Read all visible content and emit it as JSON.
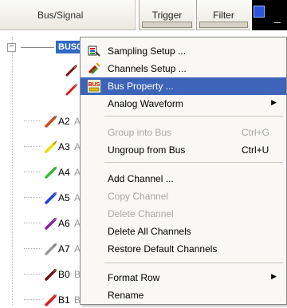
{
  "header": {
    "bus_signal_label": "Bus/Signal",
    "trigger_label": "Trigger",
    "filter_label": "Filter"
  },
  "tree": {
    "bus_name": "BUS0",
    "channels": [
      {
        "name": "A2",
        "extra": "A",
        "color": "#d24a1a"
      },
      {
        "name": "A3",
        "extra": "A",
        "color": "#e8e000"
      },
      {
        "name": "A4",
        "extra": "A",
        "color": "#2fbf2f"
      },
      {
        "name": "A5",
        "extra": "A",
        "color": "#1f3de0"
      },
      {
        "name": "A6",
        "extra": "A",
        "color": "#8a1fa8"
      },
      {
        "name": "A7",
        "extra": "A",
        "color": "#9a9a9a"
      },
      {
        "name": "B0",
        "extra": "B",
        "color": "#6a1010"
      },
      {
        "name": "B1",
        "extra": "B",
        "color": "#e01818"
      }
    ]
  },
  "context_menu": {
    "items": [
      {
        "label": "Sampling Setup ...",
        "icon": "sampling-setup-icon"
      },
      {
        "label": "Channels Setup ...",
        "icon": "channels-setup-icon"
      },
      {
        "label": "Bus Property ...",
        "icon": "bus-property-icon",
        "highlighted": true
      },
      {
        "label": "Analog Waveform",
        "submenu": true
      },
      {
        "label": "Group into Bus",
        "shortcut": "Ctrl+G",
        "disabled": true
      },
      {
        "label": "Ungroup from Bus",
        "shortcut": "Ctrl+U"
      },
      {
        "label": "Add Channel ..."
      },
      {
        "label": "Copy Channel",
        "disabled": true
      },
      {
        "label": "Delete Channel",
        "disabled": true
      },
      {
        "label": "Delete All Channels"
      },
      {
        "label": "Restore Default Channels"
      },
      {
        "label": "Format Row",
        "submenu": true
      },
      {
        "label": "Rename"
      }
    ],
    "bus_icon_text": "BUS"
  },
  "colors": {
    "selection": "#3169c6",
    "menu_highlight": "#3d64b8"
  }
}
